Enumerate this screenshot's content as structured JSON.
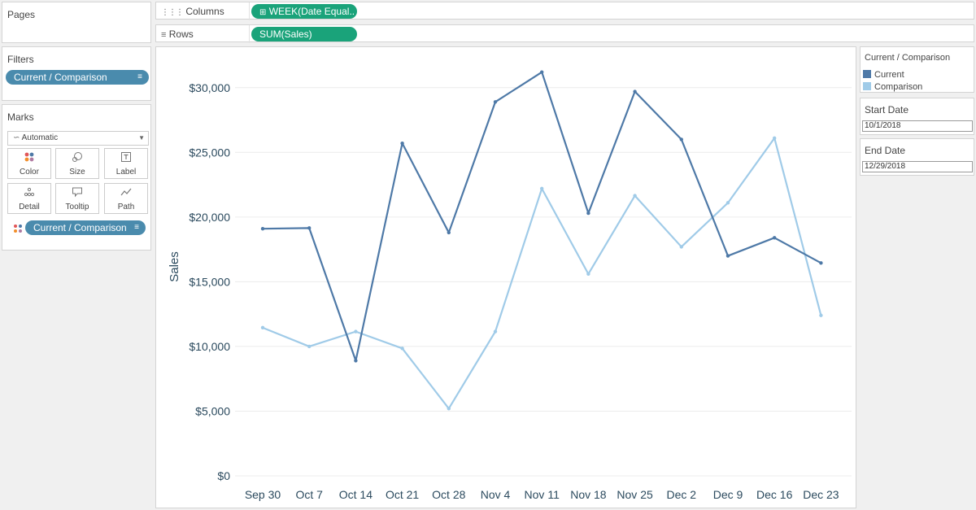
{
  "pages": {
    "title": "Pages"
  },
  "filters": {
    "title": "Filters",
    "pill": "Current / Comparison"
  },
  "marks": {
    "title": "Marks",
    "type": "Automatic",
    "buttons": [
      {
        "label": "Color",
        "icon": "color-dots-icon"
      },
      {
        "label": "Size",
        "icon": "size-icon"
      },
      {
        "label": "Label",
        "icon": "label-icon"
      },
      {
        "label": "Detail",
        "icon": "detail-icon"
      },
      {
        "label": "Tooltip",
        "icon": "tooltip-icon"
      },
      {
        "label": "Path",
        "icon": "path-icon"
      }
    ],
    "pill": "Current / Comparison"
  },
  "shelves": {
    "columns": {
      "label": "Columns",
      "pill": "WEEK(Date Equal.."
    },
    "rows": {
      "label": "Rows",
      "pill": "SUM(Sales)"
    }
  },
  "legend": {
    "title": "Current / Comparison",
    "items": [
      {
        "label": "Current",
        "color": "#4e79a7"
      },
      {
        "label": "Comparison",
        "color": "#a0cbe8"
      }
    ]
  },
  "parameters": {
    "start": {
      "title": "Start Date",
      "value": "10/1/2018"
    },
    "end": {
      "title": "End Date",
      "value": "12/29/2018"
    }
  },
  "chart_data": {
    "type": "line",
    "ylabel": "Sales",
    "categories": [
      "Sep 30",
      "Oct 7",
      "Oct 14",
      "Oct 21",
      "Oct 28",
      "Nov 4",
      "Nov 11",
      "Nov 18",
      "Nov 25",
      "Dec 2",
      "Dec 9",
      "Dec 16",
      "Dec 23"
    ],
    "yticks": [
      "$0",
      "$5,000",
      "$10,000",
      "$15,000",
      "$20,000",
      "$25,000",
      "$30,000"
    ],
    "ylim": [
      0,
      32500
    ],
    "grid": true,
    "series": [
      {
        "name": "Current",
        "color": "#4e79a7",
        "values": [
          19100,
          19150,
          8900,
          25700,
          18800,
          28900,
          31200,
          20300,
          29700,
          26000,
          17000,
          18400,
          16450
        ]
      },
      {
        "name": "Comparison",
        "color": "#a0cbe8",
        "values": [
          11450,
          10000,
          11150,
          9850,
          5200,
          11150,
          22200,
          15600,
          21650,
          17700,
          21100,
          26100,
          12400
        ]
      }
    ]
  }
}
